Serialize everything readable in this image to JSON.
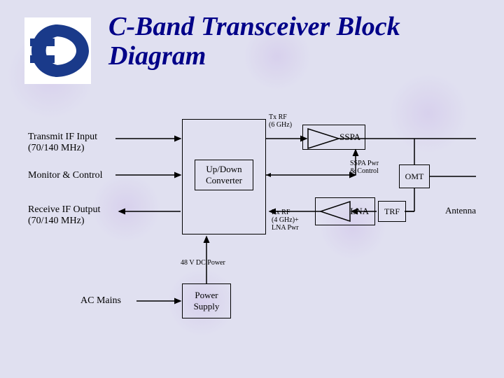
{
  "title": "C-Band Transceiver Block\nDiagram",
  "logo_icon": "transceiver-logo",
  "left_labels": {
    "transmit_if": "Transmit IF Input\n(70/140 MHz)",
    "monitor_control": "Monitor & Control",
    "receive_if": "Receive IF Output\n(70/140 MHz)",
    "ac_mains": "AC Mains"
  },
  "blocks": {
    "updown_converter": "Up/Down\nConverter",
    "sspa": "SSPA",
    "lna": "LNA",
    "omt": "OMT",
    "trf": "TRF",
    "power_supply": "Power\nSupply"
  },
  "right_label": "Antenna",
  "signal_labels": {
    "tx_rf": "Tx RF\n(6 GHz)",
    "sspa_pwr": "SSPA Pwr\n& Control",
    "rx_rf": "Rx RF\n(4 GHz)+\nLNA Pwr",
    "dc_power": "48 V DC Power"
  }
}
